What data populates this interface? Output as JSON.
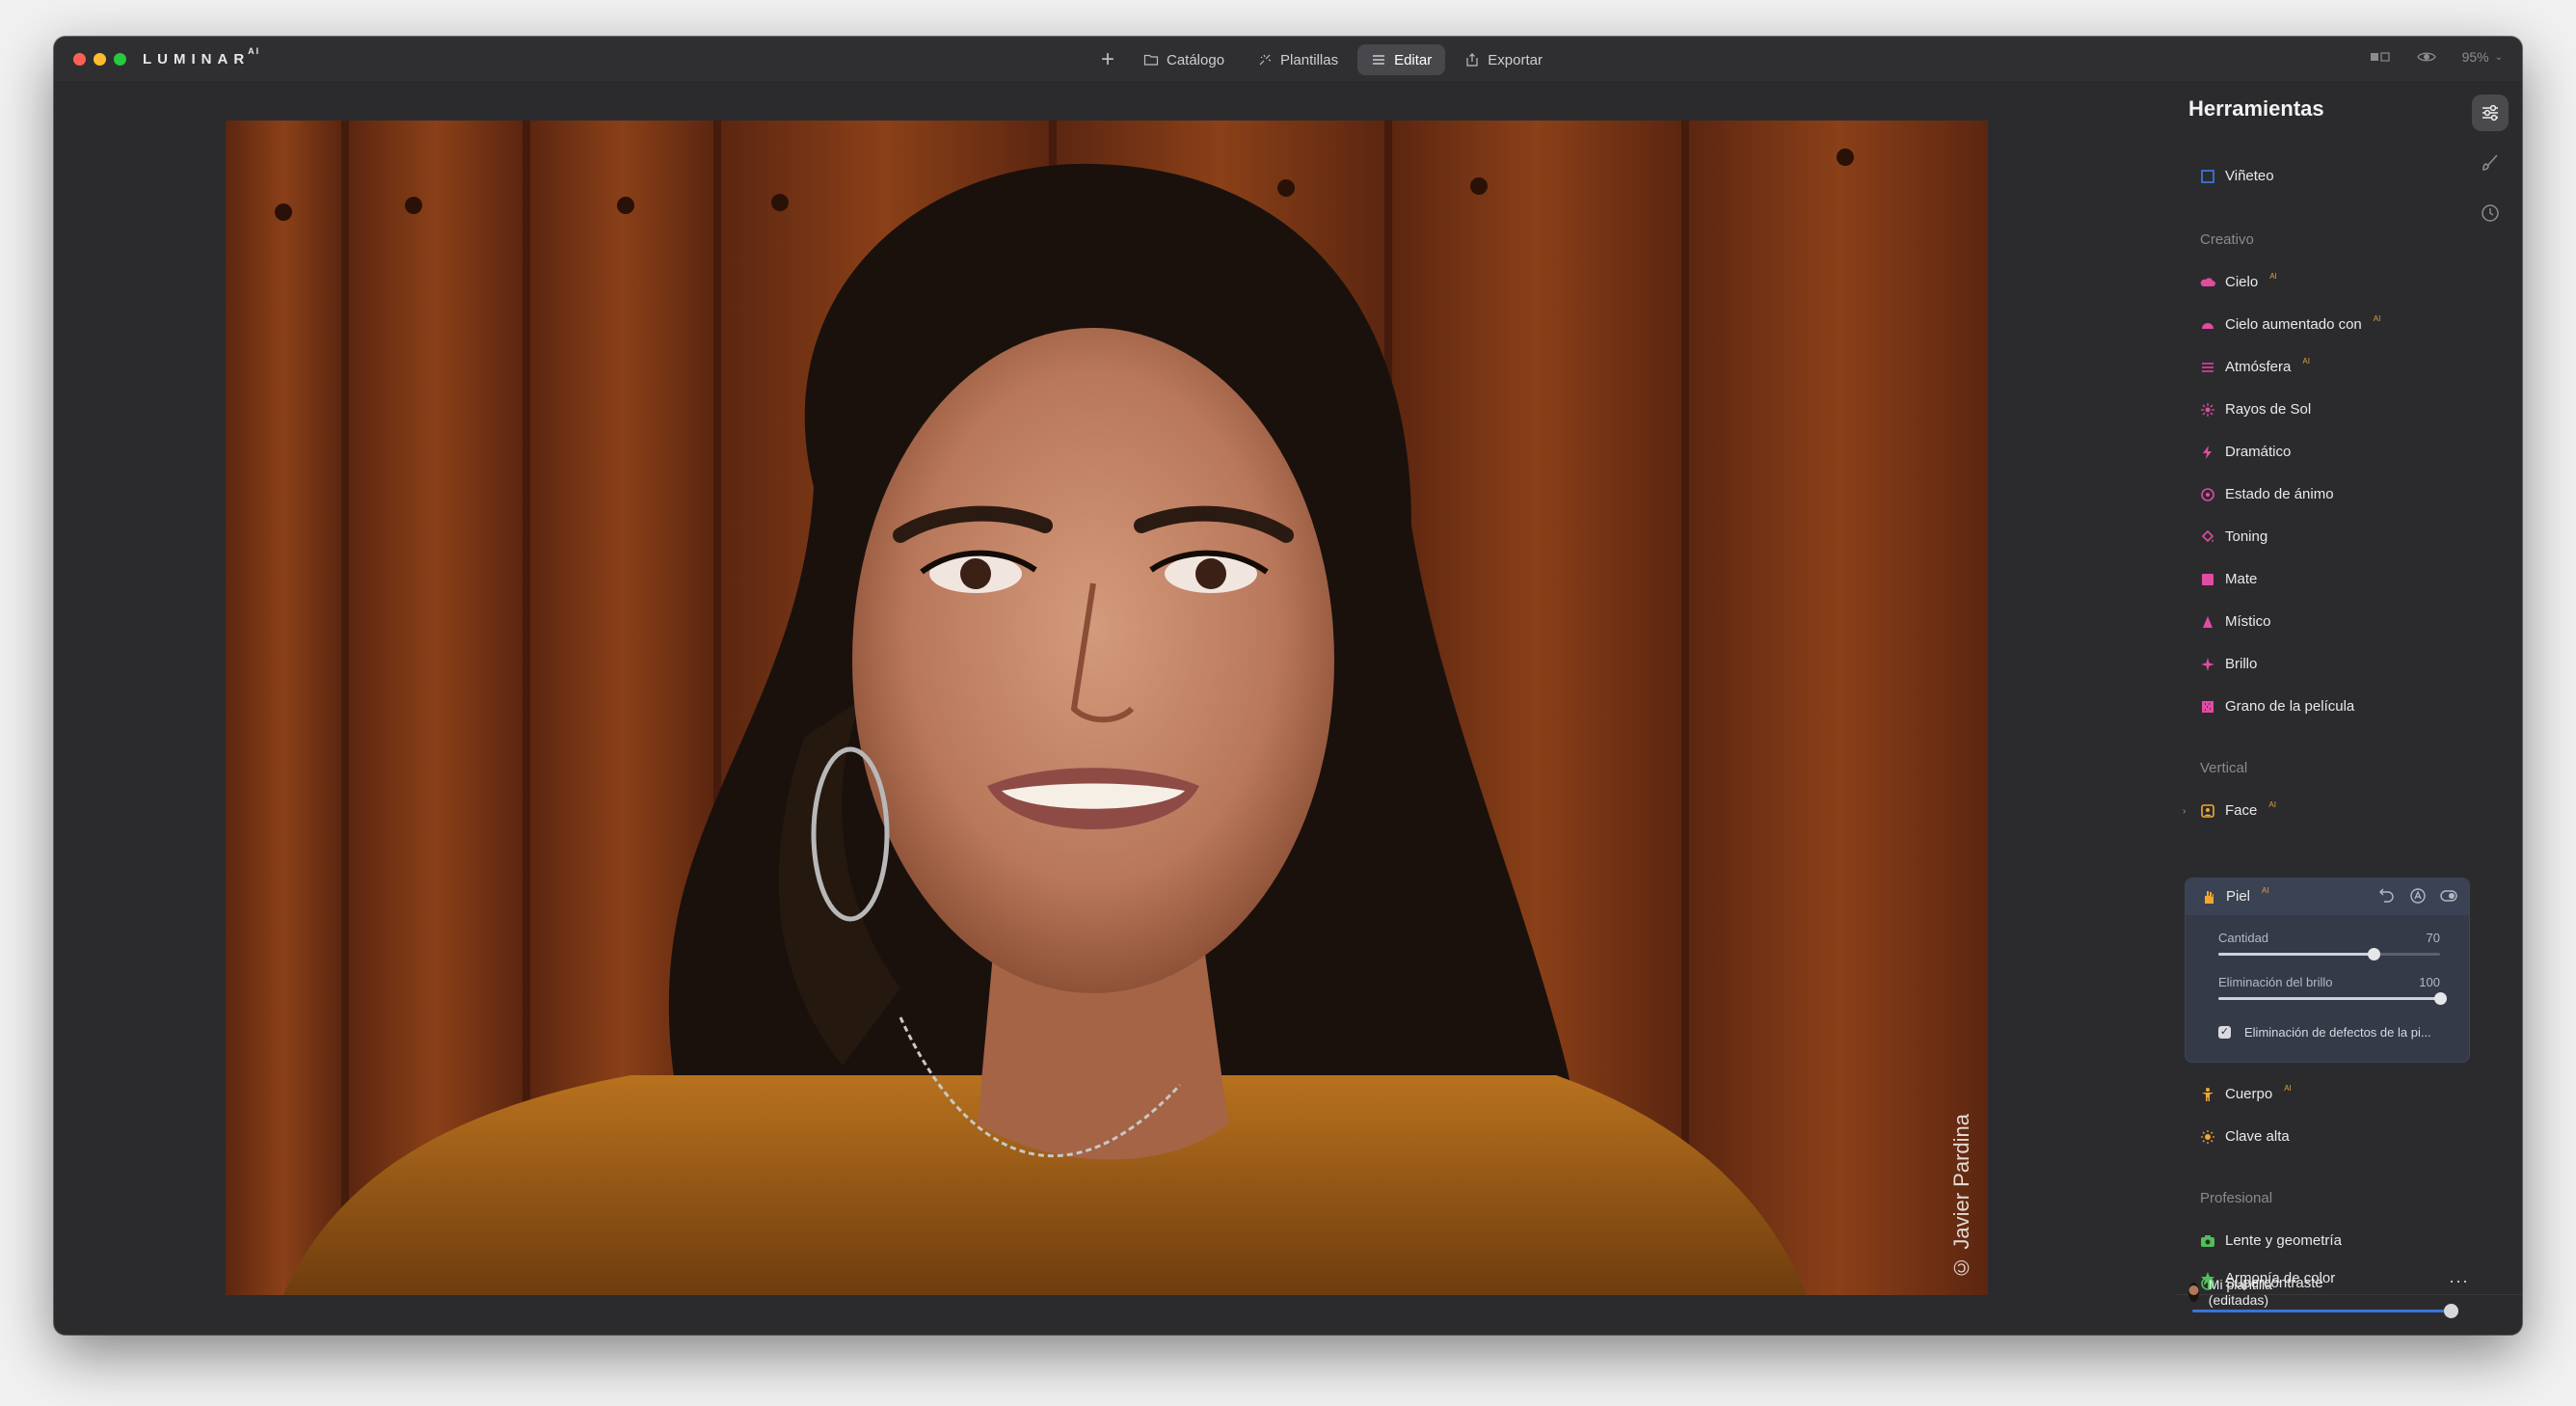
{
  "app": {
    "logo": "LUMINAR",
    "logo_suffix": "AI"
  },
  "nav": {
    "items": [
      {
        "label": "Catálogo",
        "icon": "folder-icon"
      },
      {
        "label": "Plantillas",
        "icon": "templates-icon"
      },
      {
        "label": "Editar",
        "icon": "edit-icon",
        "active": true
      },
      {
        "label": "Exportar",
        "icon": "export-icon"
      }
    ],
    "zoom": "95%"
  },
  "photo": {
    "watermark": "© Javier Pardina"
  },
  "panel": {
    "title": "Herramientas",
    "partial_item": "Viñeteo",
    "sections": {
      "creativo": "Creativo",
      "vertical": "Vertical",
      "profesional": "Profesional"
    },
    "creativo_items": [
      {
        "label": "Cielo",
        "ai": "AI",
        "color": "#e14ba0"
      },
      {
        "label": "Cielo aumentado con",
        "ai": "AI",
        "color": "#e14ba0"
      },
      {
        "label": "Atmósfera",
        "ai": "AI",
        "color": "#e14ba0"
      },
      {
        "label": "Rayos de Sol",
        "ai": "",
        "color": "#e14ba0"
      },
      {
        "label": "Dramático",
        "ai": "",
        "color": "#e14ba0"
      },
      {
        "label": "Estado de ánimo",
        "ai": "",
        "color": "#e14ba0"
      },
      {
        "label": "Toning",
        "ai": "",
        "color": "#e14ba0"
      },
      {
        "label": "Mate",
        "ai": "",
        "color": "#e14ba0"
      },
      {
        "label": "Místico",
        "ai": "",
        "color": "#e14ba0"
      },
      {
        "label": "Brillo",
        "ai": "",
        "color": "#e14ba0"
      },
      {
        "label": "Grano de la película",
        "ai": "",
        "color": "#e14ba0"
      }
    ],
    "vertical_items": {
      "face": {
        "label": "Face",
        "ai": "AI"
      },
      "piel": {
        "label": "Piel",
        "ai": "AI",
        "cantidad_label": "Cantidad",
        "cantidad_value": "70",
        "cantidad_fraction": 0.7,
        "brillo_label": "Eliminación del brillo",
        "brillo_value": "100",
        "brillo_fraction": 1.0,
        "checkbox_label": "Eliminación de defectos de la pi...",
        "checkbox_checked": true
      },
      "cuerpo": {
        "label": "Cuerpo",
        "ai": "AI"
      },
      "clave": {
        "label": "Clave alta",
        "ai": ""
      }
    },
    "profesional_items": [
      {
        "label": "Lente y geometría",
        "color": "#4fbf5a"
      },
      {
        "label": "Supercontraste",
        "color": "#4fbf5a"
      },
      {
        "label": "Armonía de color",
        "color": "#4fbf5a"
      }
    ],
    "template": {
      "label": "Mi plantilla (editadas)",
      "more": "···",
      "amount_fraction": 1.0
    }
  },
  "colors": {
    "creative_accent": "#e14ba0",
    "portrait_accent": "#f0a830",
    "professional_accent": "#4fbf5a",
    "blue_accent": "#3a73d9"
  }
}
